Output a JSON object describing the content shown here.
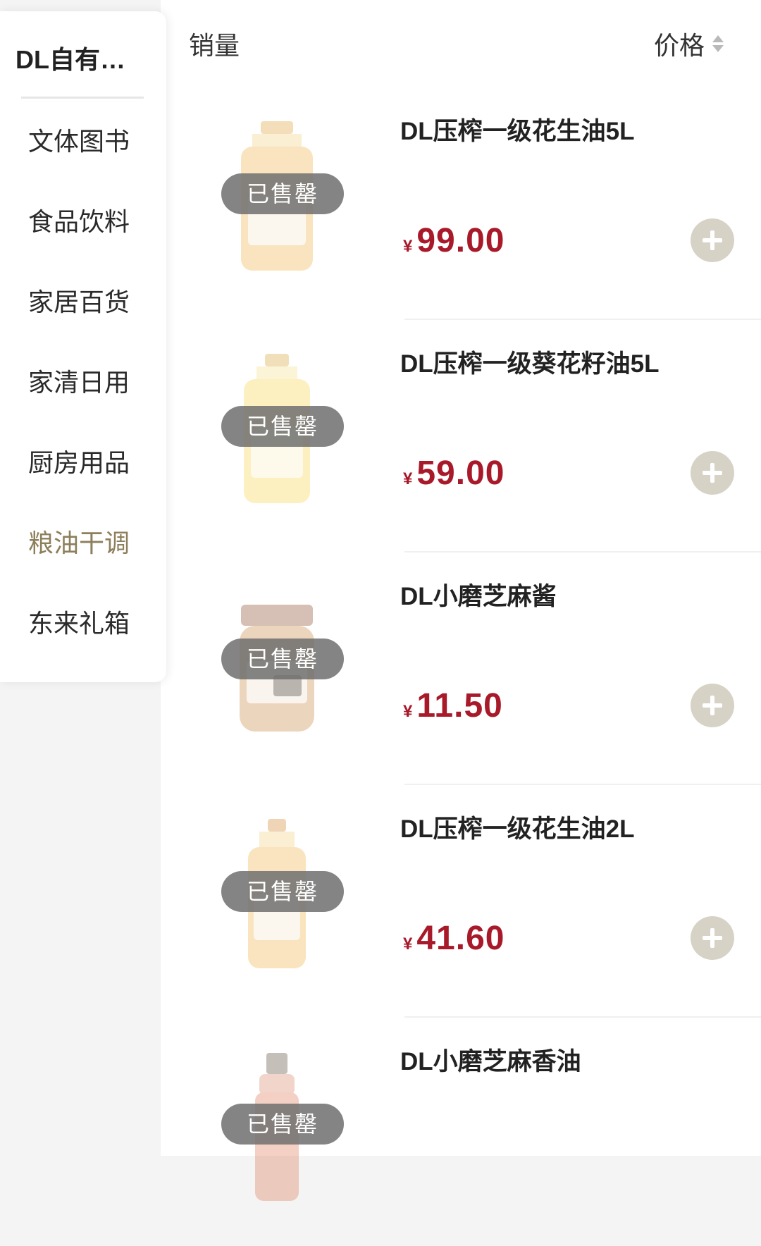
{
  "sidebar": {
    "brand": "DL自有…",
    "categories": [
      {
        "label": "文体图书"
      },
      {
        "label": "食品饮料"
      },
      {
        "label": "家居百货"
      },
      {
        "label": "家清日用"
      },
      {
        "label": "厨房用品"
      },
      {
        "label": "粮油干调",
        "active": true
      },
      {
        "label": "东来礼箱"
      }
    ]
  },
  "sort": {
    "sales_label": "销量",
    "price_label": "价格"
  },
  "products": [
    {
      "name": "DL压榨一级花生油5L",
      "currency": "¥",
      "price": "99.00",
      "status": "已售罄",
      "image_icon": "peanut-oil-bottle"
    },
    {
      "name": "DL压榨一级葵花籽油5L",
      "currency": "¥",
      "price": "59.00",
      "status": "已售罄",
      "image_icon": "sunflower-oil-bottle"
    },
    {
      "name": "DL小磨芝麻酱",
      "currency": "¥",
      "price": "11.50",
      "status": "已售罄",
      "image_icon": "sesame-paste-jar"
    },
    {
      "name": "DL压榨一级花生油2L",
      "currency": "¥",
      "price": "41.60",
      "status": "已售罄",
      "image_icon": "peanut-oil-bottle"
    },
    {
      "name": "DL小磨芝麻香油",
      "currency": "¥",
      "price": "",
      "status": "已售罄",
      "image_icon": "sesame-oil-bottle"
    }
  ],
  "colors": {
    "accent_active": "#8d7f5b",
    "price": "#a8192a",
    "add_button": "#d7d2c6"
  }
}
